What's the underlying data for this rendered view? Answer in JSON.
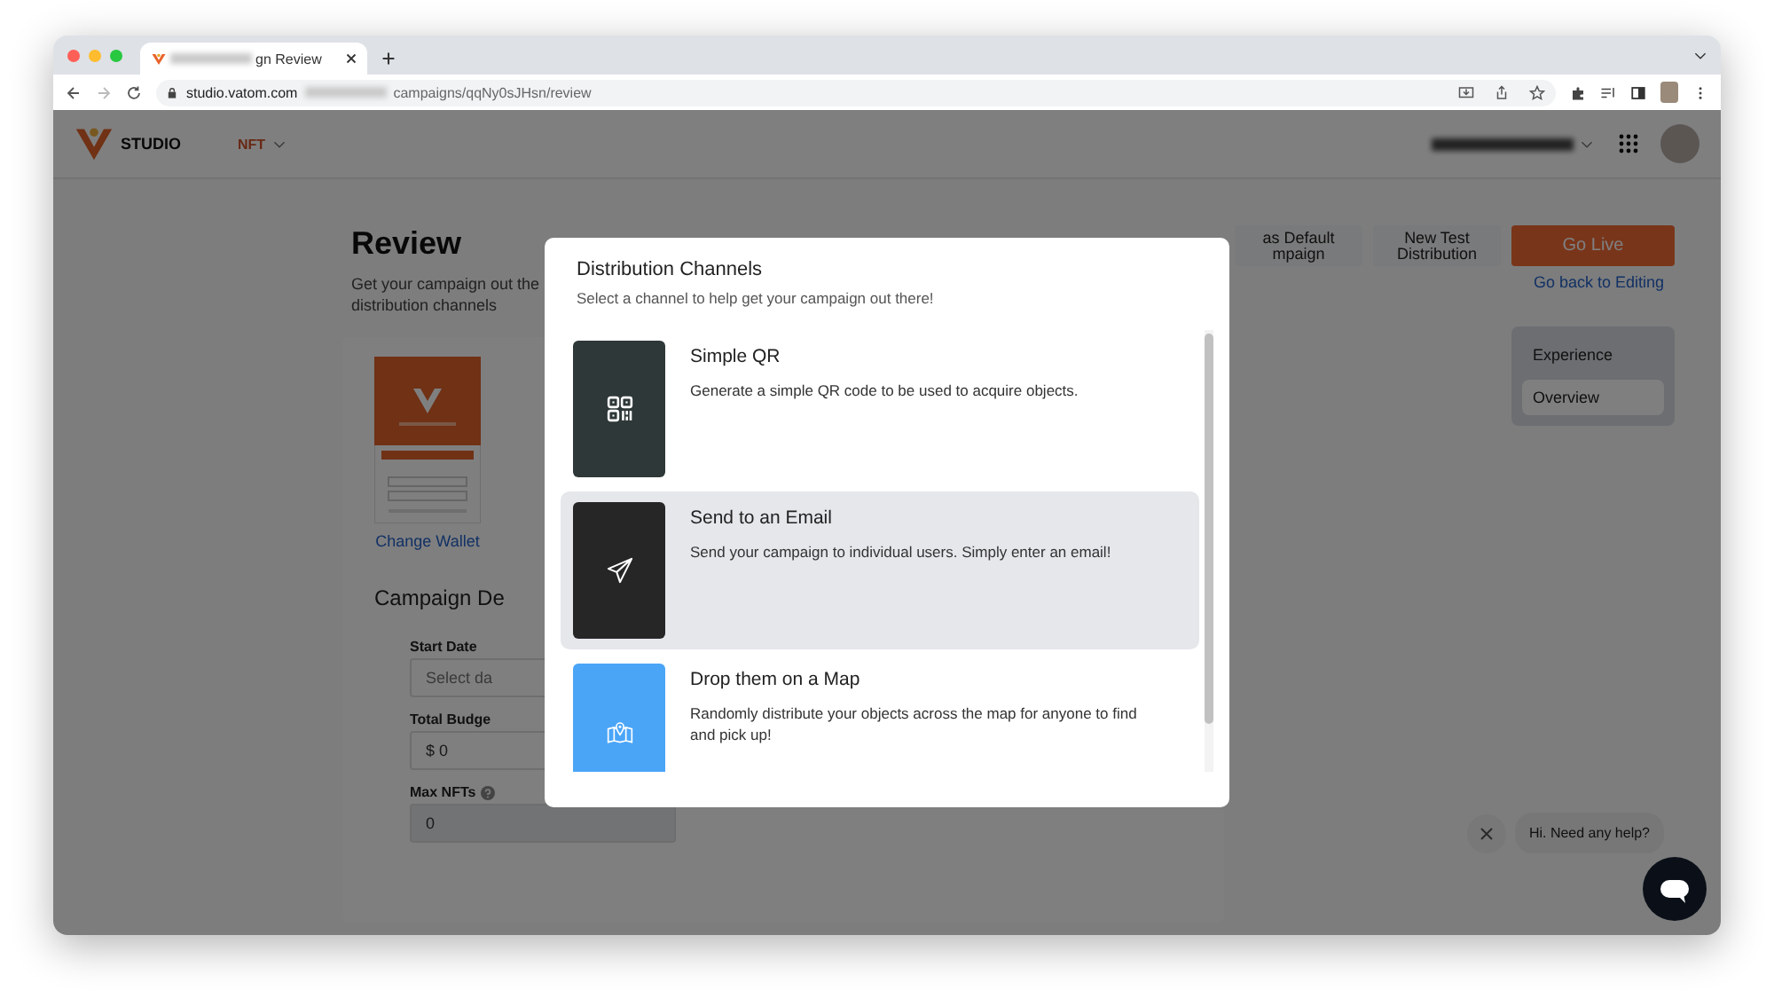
{
  "browser": {
    "tab_title": "gn Review",
    "url_host": "studio.vatom.com",
    "url_path": "campaigns/qqNy0sJHsn/review"
  },
  "header": {
    "logo_text": "STUDIO",
    "menu": "NFT"
  },
  "page": {
    "title": "Review",
    "subtitle": [
      "Get your campaign out the",
      "distribution channels"
    ],
    "actions": [
      {
        "kind": "secondary",
        "lines": [
          "as Default",
          "mpaign"
        ]
      },
      {
        "kind": "secondary",
        "lines": [
          "New Test",
          "Distribution"
        ]
      },
      {
        "kind": "primary",
        "lines": [
          "Go Live"
        ]
      }
    ],
    "back_link": "Go back to Editing",
    "side_nav": [
      {
        "label": "Experience",
        "selected": false
      },
      {
        "label": "Overview",
        "selected": true
      }
    ],
    "wallet_link": "Change Wallet",
    "details": {
      "heading": "Campaign De",
      "fields": [
        {
          "label": "Start Date",
          "placeholder": "Select da",
          "disabled": false
        },
        {
          "label": "Total Budge",
          "value": "$ 0",
          "disabled": false
        },
        {
          "label": "Max NFTs",
          "help": true,
          "value": "0",
          "disabled": true
        }
      ]
    }
  },
  "modal": {
    "title": "Distribution Channels",
    "subtitle": "Select a channel to help get your campaign out there!",
    "channels": [
      {
        "title": "Simple QR",
        "description": "Generate a simple QR code to be used to acquire objects.",
        "color": "#2f3838",
        "selected": false
      },
      {
        "title": "Send to an Email",
        "description": "Send your campaign to individual users. Simply enter an email!",
        "color": "#262626",
        "selected": true
      },
      {
        "title": "Drop them on a Map",
        "description": "Randomly distribute your objects across the map for anyone to find and pick up!",
        "color": "#4aa5f7",
        "selected": false
      }
    ]
  },
  "chat": {
    "greeting": "Hi. Need any help?"
  }
}
